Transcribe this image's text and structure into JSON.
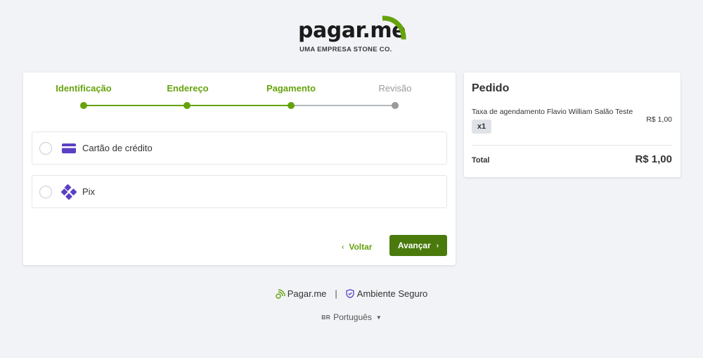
{
  "brand": {
    "name": "pagar.me",
    "tagline": "UMA EMPRESA STONE CO.",
    "accent_color": "#65a30d",
    "button_color": "#4a7a0c"
  },
  "steps": [
    {
      "label": "Identificação",
      "state": "complete"
    },
    {
      "label": "Endereço",
      "state": "complete"
    },
    {
      "label": "Pagamento",
      "state": "current"
    },
    {
      "label": "Revisão",
      "state": "pending"
    }
  ],
  "payment_methods": [
    {
      "label": "Cartão de crédito",
      "icon": "credit-card-icon",
      "selected": false
    },
    {
      "label": "Pix",
      "icon": "pix-icon",
      "selected": false
    }
  ],
  "actions": {
    "back_label": "Voltar",
    "next_label": "Avançar"
  },
  "order": {
    "title": "Pedido",
    "item_name": "Taxa de agendamento Flavio William Salão Teste",
    "item_price": "R$ 1,00",
    "item_qty": "x1",
    "total_label": "Total",
    "total_value": "R$ 1,00"
  },
  "footer": {
    "pagarme_label": "Pagar.me",
    "separator": "|",
    "secure_label": "Ambiente Seguro",
    "language_code": "BR",
    "language_label": "Português"
  }
}
